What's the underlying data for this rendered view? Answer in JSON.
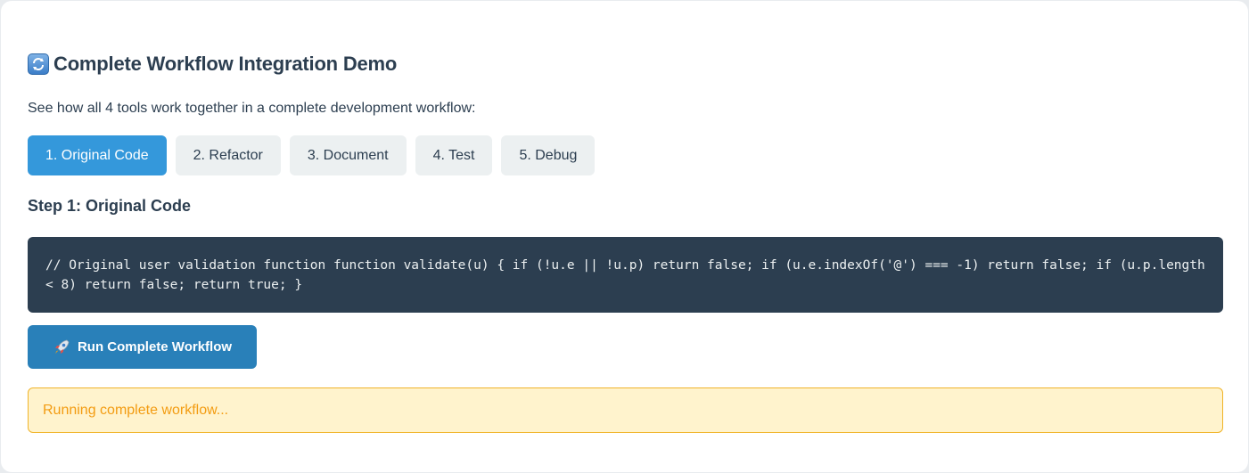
{
  "header": {
    "icon": "refresh-icon",
    "title": "Complete Workflow Integration Demo",
    "subtitle": "See how all 4 tools work together in a complete development workflow:"
  },
  "steps": [
    {
      "label": "1. Original Code",
      "active": true
    },
    {
      "label": "2. Refactor",
      "active": false
    },
    {
      "label": "3. Document",
      "active": false
    },
    {
      "label": "4. Test",
      "active": false
    },
    {
      "label": "5. Debug",
      "active": false
    }
  ],
  "current_step": {
    "heading": "Step 1: Original Code",
    "code": "// Original user validation function function validate(u) { if (!u.e || !u.p) return false; if (u.e.indexOf('@') === -1) return false; if (u.p.length < 8) return false; return true; }"
  },
  "run_button": {
    "icon": "rocket-icon",
    "label": "Run Complete Workflow"
  },
  "status": {
    "text": "Running complete workflow..."
  },
  "colors": {
    "accent": "#3498db",
    "run_button": "#2980b9",
    "code_bg": "#2c3e50",
    "status_bg": "#fff3cd",
    "status_text": "#f39c12"
  }
}
